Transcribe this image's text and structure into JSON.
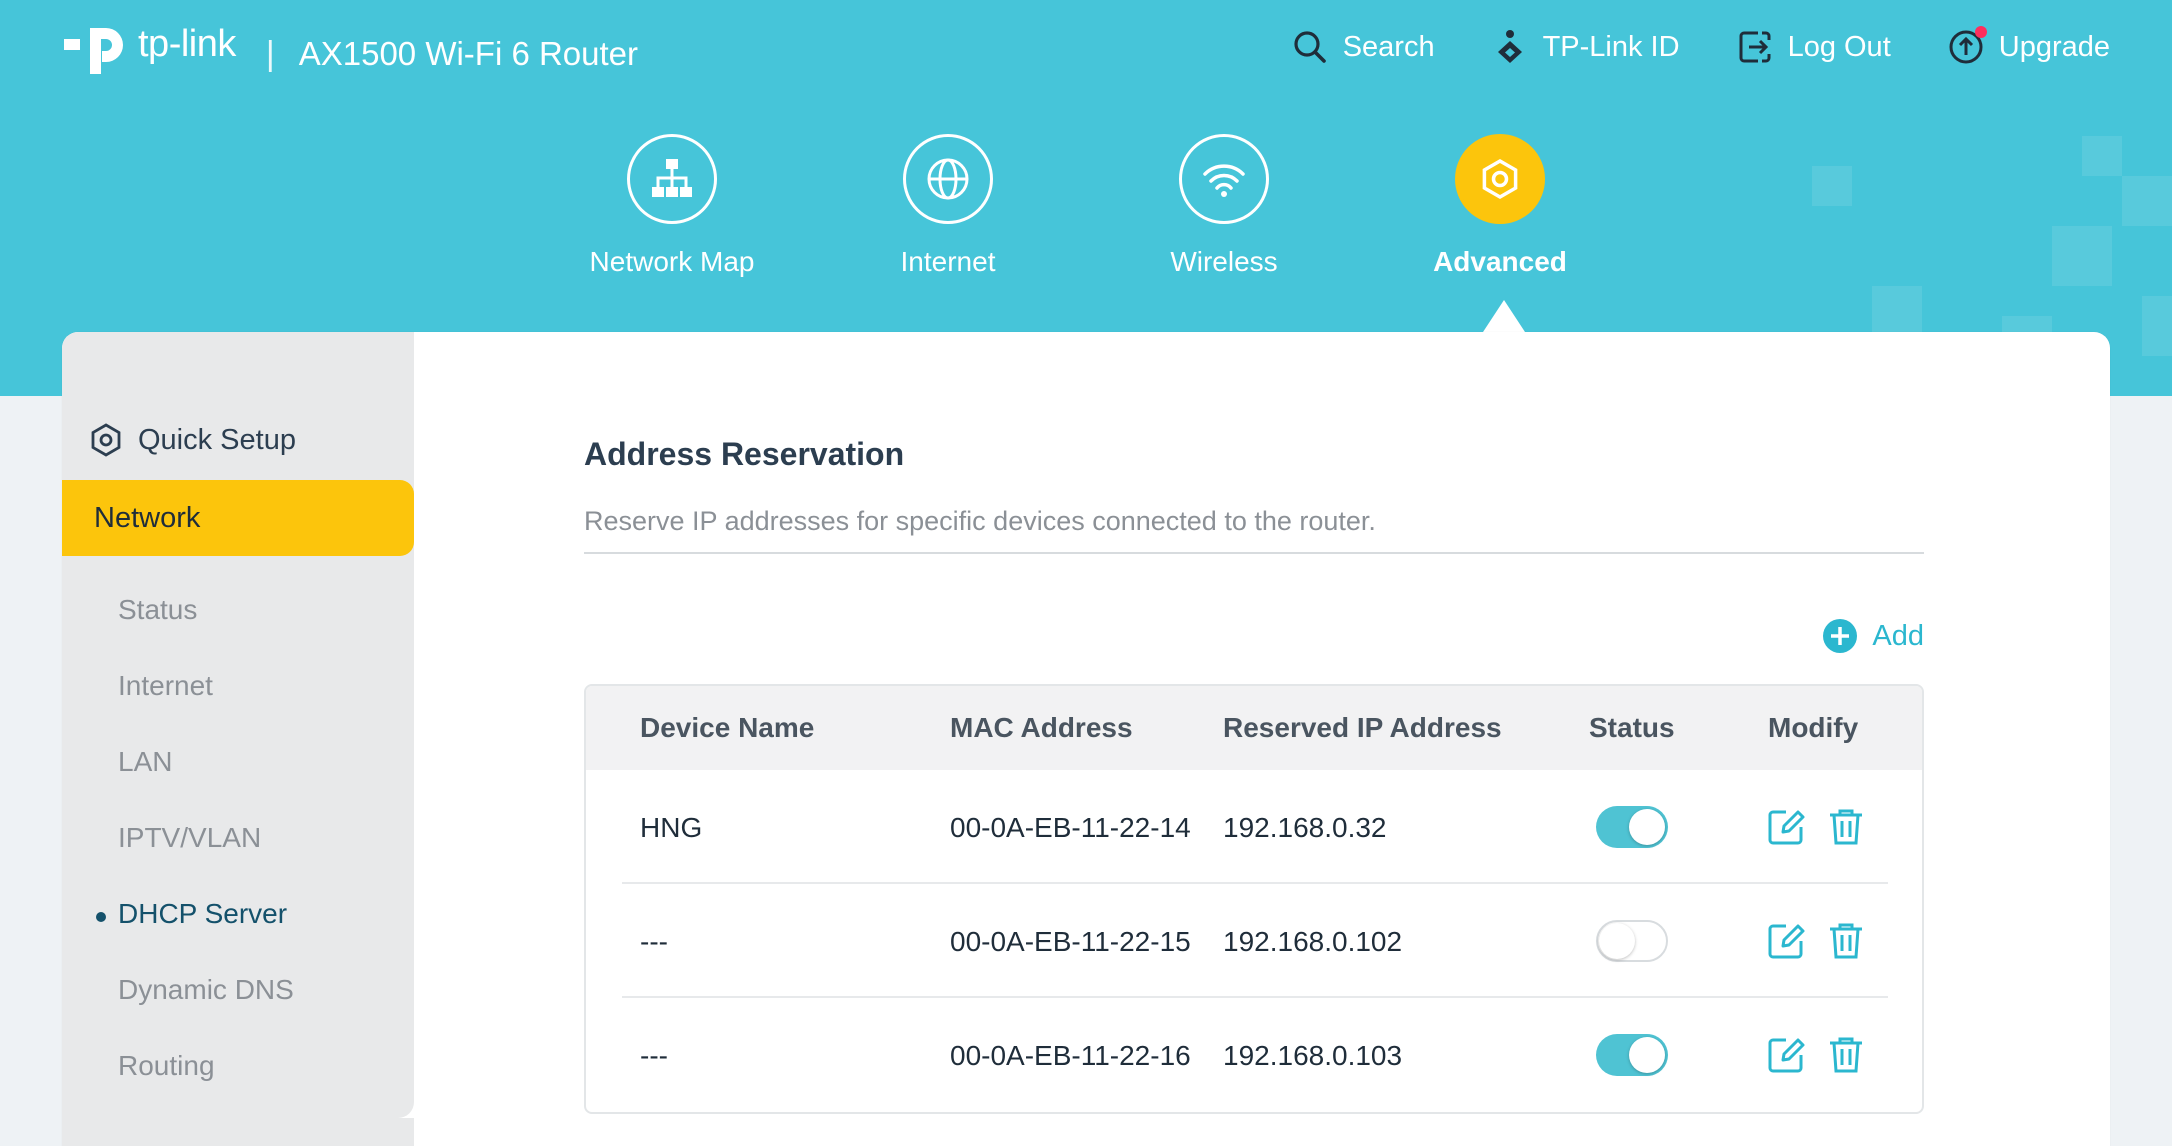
{
  "header": {
    "brand": "tp-link",
    "separator": "|",
    "model": "AX1500 Wi-Fi 6 Router",
    "bg_color": "#46c5d9"
  },
  "topnav": {
    "search": "Search",
    "tplink_id": "TP-Link ID",
    "logout": "Log Out",
    "upgrade": "Upgrade"
  },
  "mainnav": [
    {
      "label": "Network Map",
      "icon": "network-map-icon"
    },
    {
      "label": "Internet",
      "icon": "globe-icon"
    },
    {
      "label": "Wireless",
      "icon": "wifi-icon"
    },
    {
      "label": "Advanced",
      "icon": "gear-icon",
      "active": true
    }
  ],
  "sidebar": {
    "quick_setup": "Quick Setup",
    "network": "Network",
    "items": [
      "Status",
      "Internet",
      "LAN",
      "IPTV/VLAN",
      "DHCP Server",
      "Dynamic DNS",
      "Routing"
    ],
    "active_item": "DHCP Server"
  },
  "content": {
    "title": "Address Reservation",
    "description": "Reserve IP addresses for specific devices connected to the router.",
    "add_label": "Add",
    "accent_color": "#2bb7cf"
  },
  "table": {
    "headers": [
      "Device Name",
      "MAC Address",
      "Reserved IP Address",
      "Status",
      "Modify"
    ],
    "rows": [
      {
        "device": "HNG",
        "mac": "00-0A-EB-11-22-14",
        "ip": "192.168.0.32",
        "enabled": true
      },
      {
        "device": "---",
        "mac": "00-0A-EB-11-22-15",
        "ip": "192.168.0.102",
        "enabled": false
      },
      {
        "device": "---",
        "mac": "00-0A-EB-11-22-16",
        "ip": "192.168.0.103",
        "enabled": true
      }
    ]
  }
}
